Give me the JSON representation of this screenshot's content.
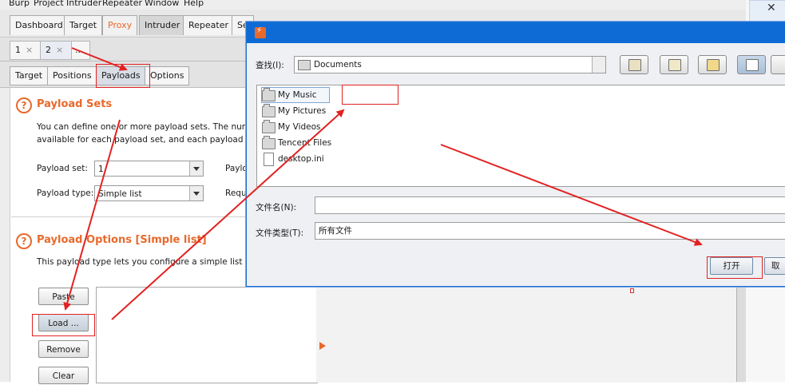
{
  "menu": [
    "Burp",
    "Project",
    "Intruder",
    "Repeater",
    "Window",
    "Help"
  ],
  "main_tabs": [
    "Dashboard",
    "Target",
    "Proxy",
    "Intruder",
    "Repeater",
    "Se"
  ],
  "intruder_tabs": [
    "1",
    "2",
    "..."
  ],
  "close_glyph": "×",
  "payload_tabs": [
    "Target",
    "Positions",
    "Payloads",
    "Options"
  ],
  "payload_sets": {
    "icon": "?",
    "title": "Payload Sets",
    "desc_line1": "You can define one or more payload sets. The number",
    "desc_line2": "available for each payload set, and each payload type",
    "set_label": "Payload set:",
    "set_value": "1",
    "type_label": "Payload type:",
    "type_value": "Simple list",
    "right_label1": "Paylo",
    "right_label2": "Reque"
  },
  "payload_options": {
    "icon": "?",
    "title": "Payload Options [Simple list]",
    "desc": "This payload type lets you configure a simple list of str",
    "buttons": [
      "Paste",
      "Load ...",
      "Remove",
      "Clear"
    ]
  },
  "dialog": {
    "lookin_label": "查找(I):",
    "lookin_value": "Documents",
    "files": [
      {
        "name": "My Music",
        "type": "folder"
      },
      {
        "name": "My Pictures",
        "type": "folder"
      },
      {
        "name": "My Videos",
        "type": "folder"
      },
      {
        "name": "Tencent Files",
        "type": "folder"
      },
      {
        "name": "desktop.ini",
        "type": "file"
      }
    ],
    "filename_label": "文件名(N):",
    "filename_value": "",
    "filetype_label": "文件类型(T):",
    "filetype_value": "所有文件",
    "open_label": "打开",
    "cancel_label": "取"
  },
  "colors": {
    "accent": "#e8692b",
    "dialog_title": "#0e6bd6",
    "annotation": "#e22222"
  }
}
